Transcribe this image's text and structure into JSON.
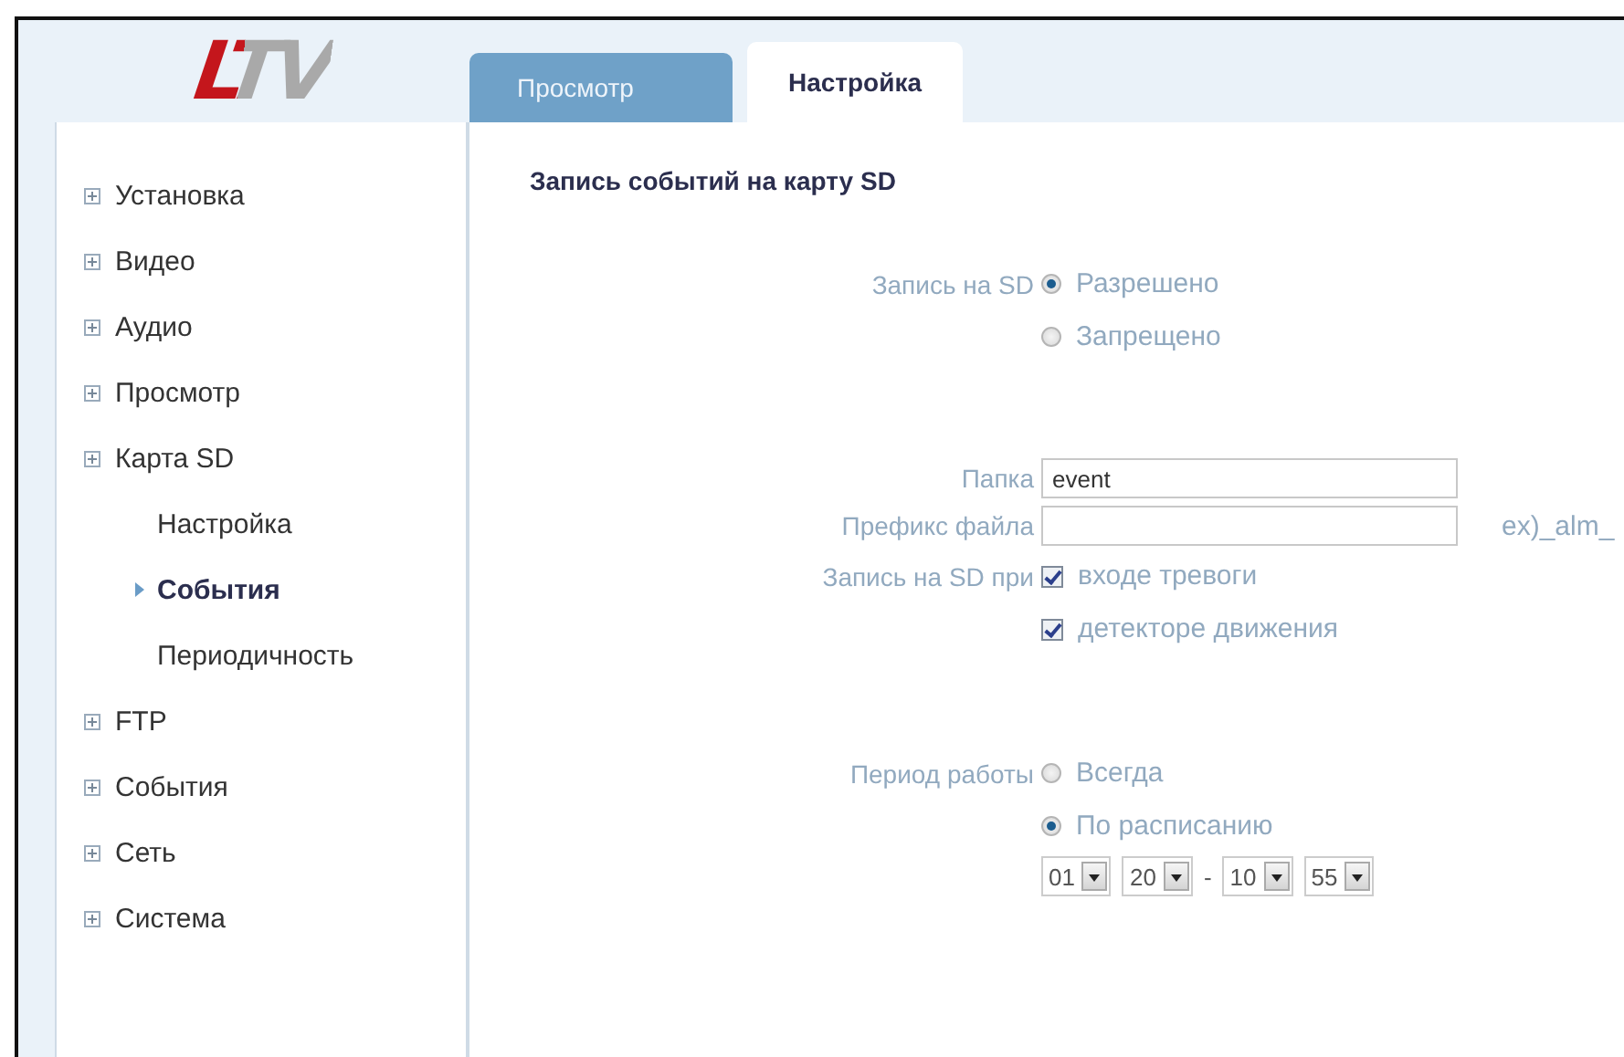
{
  "logo": "LTV",
  "tabs": [
    {
      "label": "Просмотр",
      "selected": false
    },
    {
      "label": "Настройка",
      "selected": true
    }
  ],
  "sidebar": {
    "items": [
      {
        "label": "Установка"
      },
      {
        "label": "Видео"
      },
      {
        "label": "Аудио"
      },
      {
        "label": "Просмотр"
      },
      {
        "label": "Карта SD",
        "children": [
          {
            "label": "Настройка",
            "selected": false
          },
          {
            "label": "События",
            "selected": true
          },
          {
            "label": "Периодичность",
            "selected": false
          }
        ]
      },
      {
        "label": "FTP"
      },
      {
        "label": "События"
      },
      {
        "label": "Сеть"
      },
      {
        "label": "Система"
      }
    ]
  },
  "form": {
    "title": "Запись событий на карту SD",
    "rows": [
      {
        "kind": "radio",
        "label": "Запись на SD",
        "options": [
          {
            "label": "Разрешено",
            "selected": true
          },
          {
            "label": "Запрещено",
            "selected": false
          }
        ]
      },
      {
        "kind": "spacer"
      },
      {
        "kind": "text",
        "label": "Папка",
        "value": "event"
      },
      {
        "kind": "text",
        "label": "Префикс файла",
        "hint": "ex)_alm_"
      },
      {
        "kind": "checks",
        "label": "Запись на SD при",
        "options": [
          {
            "label": "входе тревоги",
            "checked": true
          },
          {
            "label": "детекторе движения",
            "checked": true
          }
        ]
      },
      {
        "kind": "spacer"
      },
      {
        "kind": "radio",
        "label": "Период работы",
        "options": [
          {
            "label": "Всегда",
            "selected": false
          },
          {
            "label": "По расписанию",
            "selected": true
          }
        ]
      },
      {
        "kind": "time",
        "start": [
          "01",
          "20"
        ],
        "separator": "-",
        "end": [
          "10",
          "55"
        ]
      }
    ]
  }
}
